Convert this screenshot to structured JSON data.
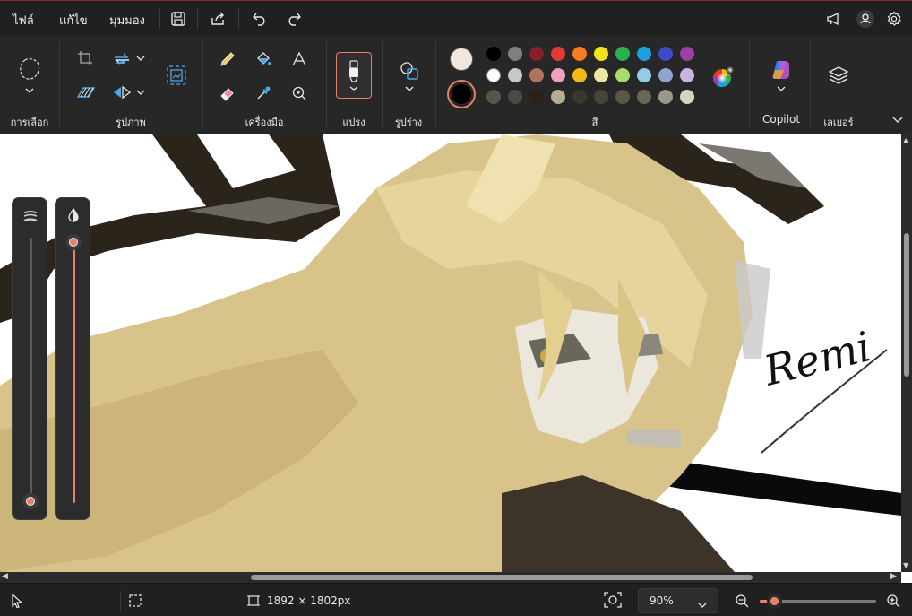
{
  "menu": {
    "file": "ไฟล์",
    "edit": "แก้ไข",
    "view": "มุมมอง"
  },
  "ribbon": {
    "groups": {
      "selection": "การเลือก",
      "image": "รูปภาพ",
      "tools": "เครื่องมือ",
      "brushes": "แปรง",
      "shapes": "รูปร่าง",
      "colors": "สี",
      "copilot": "Copilot",
      "layers": "เลเยอร์"
    },
    "primary_color": "#f1e7dc",
    "secondary_color": "#000000",
    "palette_row1": [
      "#000000",
      "#7f7f7f",
      "#8a1e2a",
      "#e53935",
      "#f57c1f",
      "#f2e21b",
      "#28b24b",
      "#1ea0e0",
      "#3d4bc4",
      "#9c3fa8"
    ],
    "palette_row2": [
      "#ffffff",
      "#c8c8c8",
      "#b0745a",
      "#f0a0c0",
      "#f5b918",
      "#efe6a6",
      "#a6dc6e",
      "#92cde8",
      "#8fa3cf",
      "#c8b4dc"
    ],
    "palette_row3": [
      "#5a544a",
      "#4c4a42",
      "#2a2218",
      "#b4ad92",
      "#3a372f",
      "#47443a",
      "#5a5747",
      "#6a6757",
      "#9a9785",
      "#d8d2c0"
    ]
  },
  "canvas": {
    "signature_text": "Remi"
  },
  "status": {
    "image_size": "1892 × 1802px",
    "zoom": "90%"
  }
}
